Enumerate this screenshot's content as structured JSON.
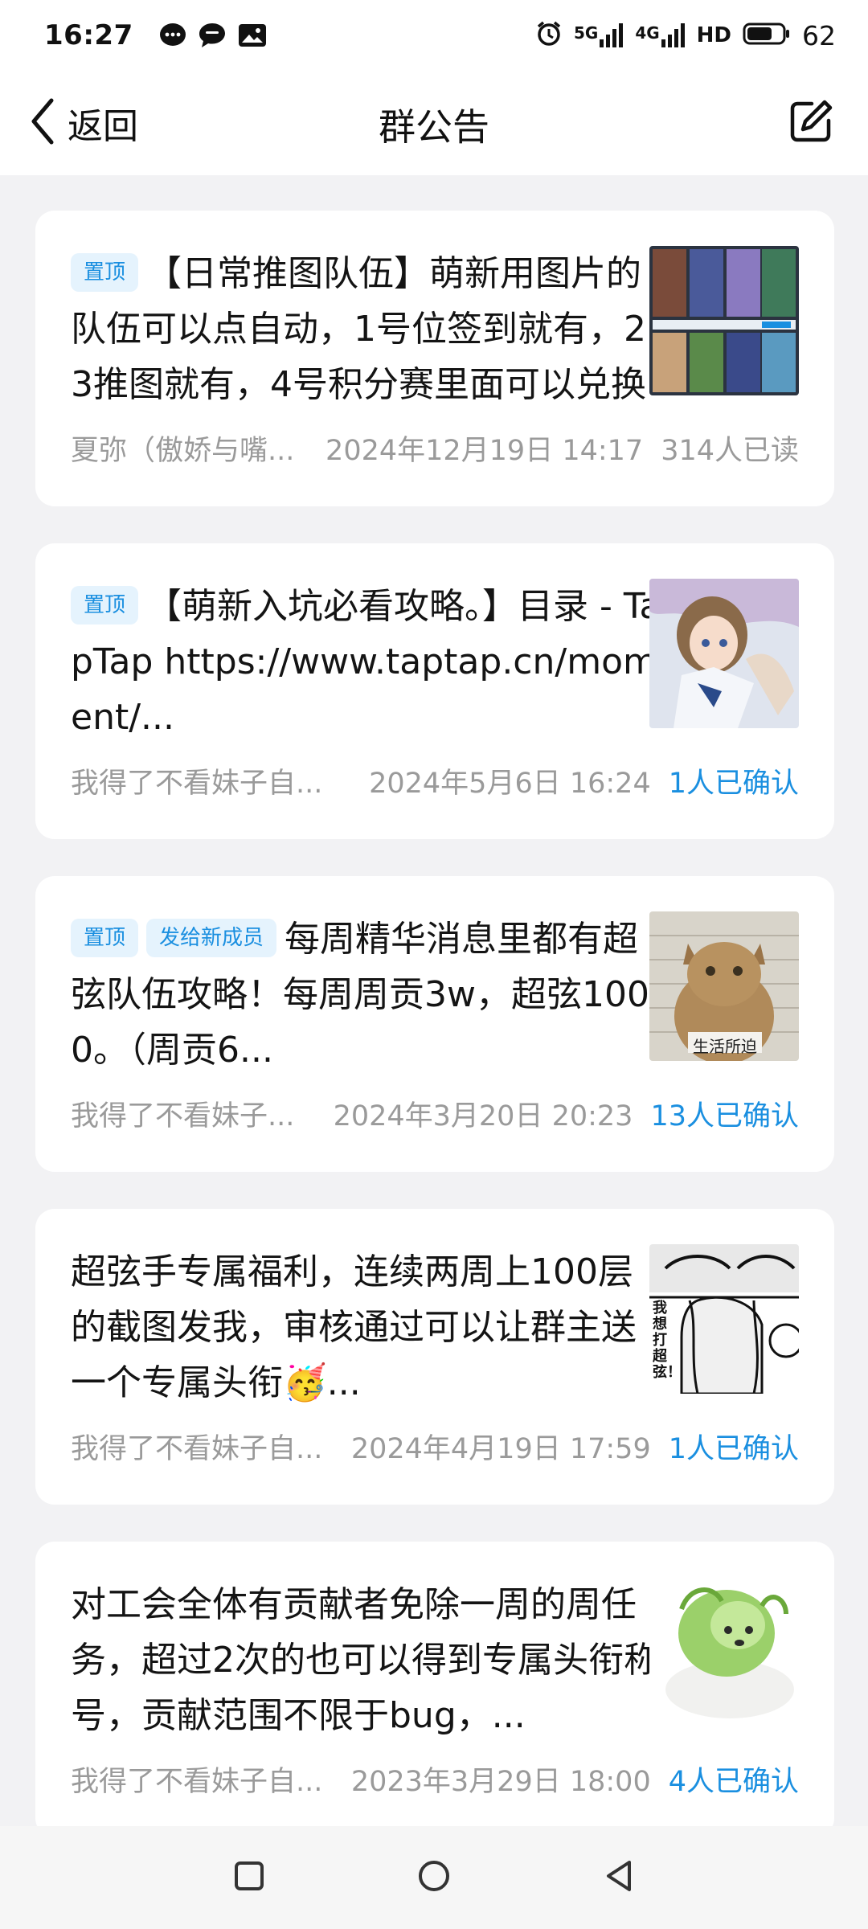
{
  "status_bar": {
    "time": "16:27",
    "notification_icons": [
      "chat-bubble-icon",
      "message-icon",
      "image-icon"
    ],
    "signal_5g": "5G",
    "signal_4g": "4G",
    "hd_label": "HD",
    "battery_level": "62"
  },
  "header": {
    "back_label": "返回",
    "title": "群公告",
    "edit_icon": "edit-icon"
  },
  "announcements": [
    {
      "tags": [
        "置顶"
      ],
      "text": "【日常推图队伍】萌新用图片的队伍可以点自动，1号位签到就有，23推图就有，4号积分赛里面可以兑换",
      "author": "夏弥（傲娇与嘴...",
      "time": "2024年12月19日 14:17",
      "stat": "314人已读",
      "stat_type": "read",
      "thumb": "game-team-screenshot"
    },
    {
      "tags": [
        "置顶"
      ],
      "text": "【萌新入坑必看攻略。】目录 - TapTap https://www.taptap.cn/moment/...",
      "author": "我得了不看妹子自...",
      "time": "2024年5月6日 16:24",
      "stat": "1人已确认",
      "stat_type": "confirm",
      "thumb": "anime-girl-illustration"
    },
    {
      "tags": [
        "置顶",
        "发给新成员"
      ],
      "text": "每周精华消息里都有超弦队伍攻略！每周周贡3w，超弦1000。（周贡6...",
      "author": "我得了不看妹子...",
      "time": "2024年3月20日 20:23",
      "stat": "13人已确认",
      "stat_type": "confirm",
      "thumb": "cat-mugshot",
      "thumb_caption": "生活所迫"
    },
    {
      "tags": [],
      "text": "超弦手专属福利，连续两周上100层的截图发我，审核通过可以让群主送一个专属头衔🥳...",
      "author": "我得了不看妹子自...",
      "time": "2024年4月19日 17:59",
      "stat": "1人已确认",
      "stat_type": "confirm",
      "thumb": "manga-meme",
      "thumb_caption": "我想打超弦！"
    },
    {
      "tags": [],
      "text": "对工会全体有贡献者免除一周的周任务，超过2次的也可以得到专属头衔称号，贡献范围不限于bug，...",
      "author": "我得了不看妹子自...",
      "time": "2023年3月29日 18:00",
      "stat": "4人已确认",
      "stat_type": "confirm",
      "thumb": "cabbage-dog"
    }
  ],
  "nav_bar": {
    "recents_icon": "square-icon",
    "home_icon": "circle-icon",
    "back_icon": "triangle-back-icon"
  },
  "colors": {
    "accent": "#1a8fe0",
    "tag_bg": "#e5f3fd",
    "page_bg": "#f2f2f4",
    "muted_text": "#9a9a9a"
  }
}
